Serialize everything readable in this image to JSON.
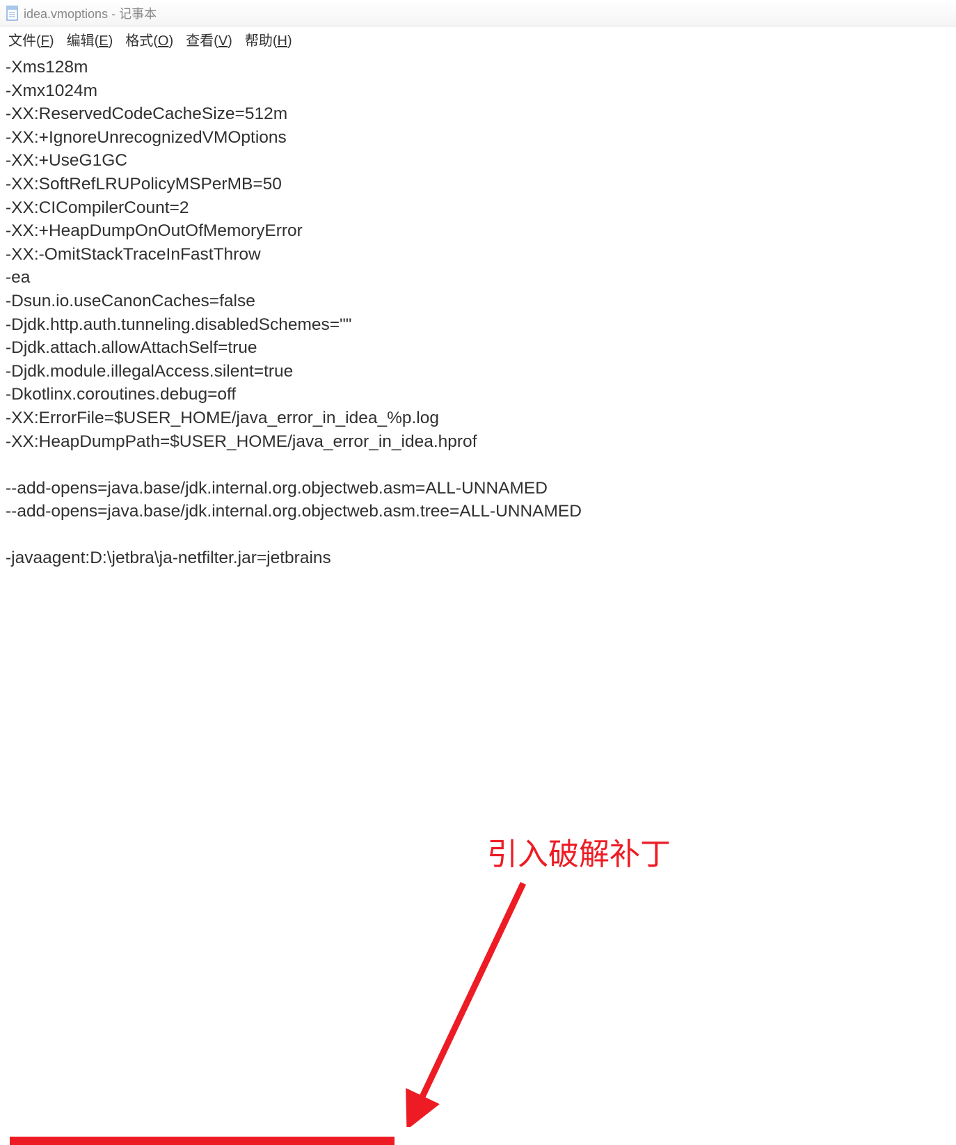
{
  "window": {
    "title": "idea.vmoptions - 记事本"
  },
  "menu": {
    "file": "文件",
    "file_key": "F",
    "edit": "编辑",
    "edit_key": "E",
    "format": "格式",
    "format_key": "O",
    "view": "查看",
    "view_key": "V",
    "help": "帮助",
    "help_key": "H"
  },
  "content": {
    "lines": [
      "-Xms128m",
      "-Xmx1024m",
      "-XX:ReservedCodeCacheSize=512m",
      "-XX:+IgnoreUnrecognizedVMOptions",
      "-XX:+UseG1GC",
      "-XX:SoftRefLRUPolicyMSPerMB=50",
      "-XX:CICompilerCount=2",
      "-XX:+HeapDumpOnOutOfMemoryError",
      "-XX:-OmitStackTraceInFastThrow",
      "-ea",
      "-Dsun.io.useCanonCaches=false",
      "-Djdk.http.auth.tunneling.disabledSchemes=\"\"",
      "-Djdk.attach.allowAttachSelf=true",
      "-Djdk.module.illegalAccess.silent=true",
      "-Dkotlinx.coroutines.debug=off",
      "-XX:ErrorFile=$USER_HOME/java_error_in_idea_%p.log",
      "-XX:HeapDumpPath=$USER_HOME/java_error_in_idea.hprof",
      "",
      "--add-opens=java.base/jdk.internal.org.objectweb.asm=ALL-UNNAMED",
      "--add-opens=java.base/jdk.internal.org.objectweb.asm.tree=ALL-UNNAMED",
      "",
      "-javaagent:D:\\jetbra\\ja-netfilter.jar=jetbrains"
    ]
  },
  "annotation": {
    "label": "引入破解补丁",
    "colors": {
      "red": "#ed1c24"
    }
  }
}
